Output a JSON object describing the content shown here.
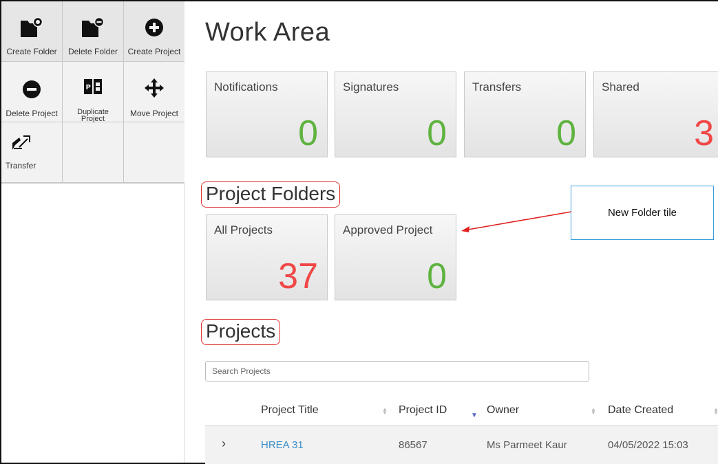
{
  "toolbar": {
    "create_folder": "Create Folder",
    "delete_folder": "Delete Folder",
    "create_project": "Create Project",
    "delete_project": "Delete Project",
    "duplicate_project_line1": "Duplicate",
    "duplicate_project_line2": "Project",
    "move_project": "Move Project",
    "transfer": "Transfer"
  },
  "page_title": "Work Area",
  "summary_tiles": [
    {
      "label": "Notifications",
      "count": "0",
      "color": "#5fb340"
    },
    {
      "label": "Signatures",
      "count": "0",
      "color": "#5fb340"
    },
    {
      "label": "Transfers",
      "count": "0",
      "color": "#5fb340"
    },
    {
      "label": "Shared",
      "count": "3",
      "color": "#f04747"
    }
  ],
  "project_folders": {
    "title": "Project Folders",
    "tiles": [
      {
        "label": "All Projects",
        "count": "37",
        "color": "#f04747"
      },
      {
        "label": "Approved Project",
        "count": "0",
        "color": "#5fb340"
      }
    ]
  },
  "annotation": {
    "callout_text": "New Folder tile",
    "highlight_color": "#e03030",
    "callout_border": "#3aa0e0"
  },
  "projects": {
    "title": "Projects",
    "search_placeholder": "Search Projects",
    "columns": [
      "Project Title",
      "Project ID",
      "Owner",
      "Date Created"
    ],
    "sorted_column": "Project ID",
    "rows": [
      {
        "expand_icon": "chevron-right-icon",
        "title": "HREA 31",
        "id": "86567",
        "owner": "Ms Parmeet Kaur",
        "date_created": "04/05/2022 15:03"
      }
    ]
  }
}
